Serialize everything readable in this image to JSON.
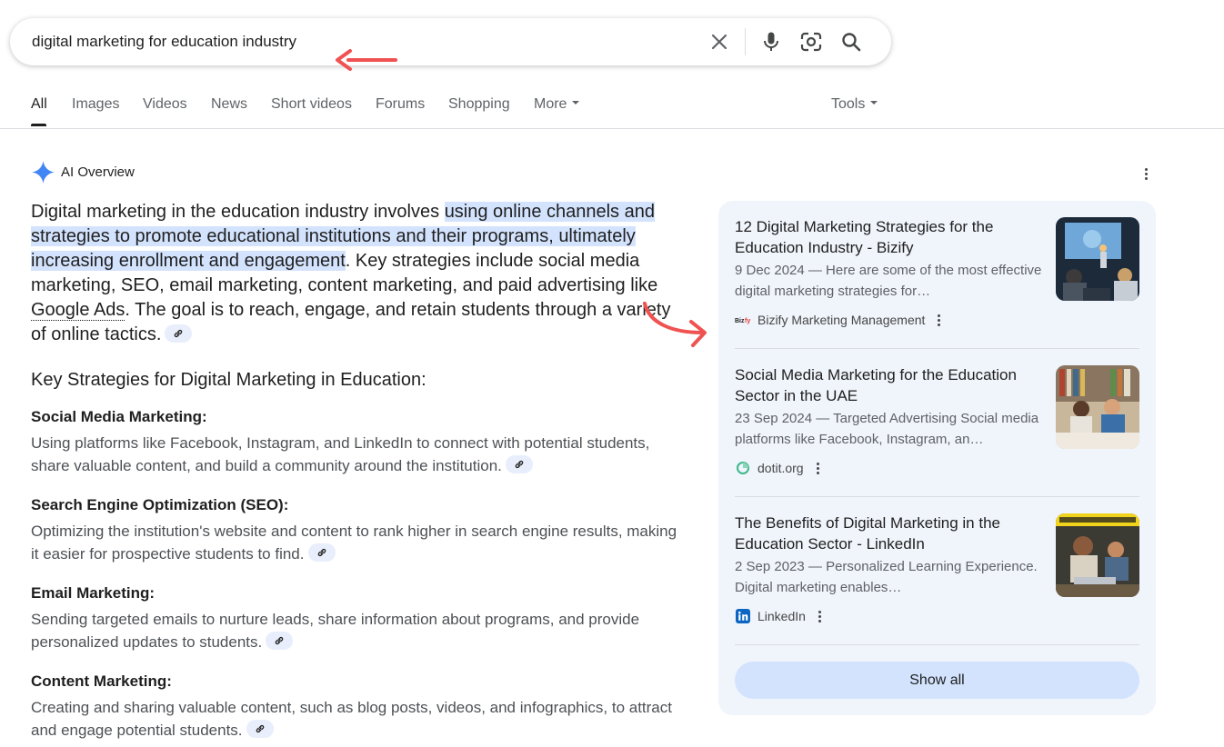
{
  "search": {
    "query": "digital marketing for education industry"
  },
  "tabs": [
    {
      "label": "All",
      "active": true
    },
    {
      "label": "Images"
    },
    {
      "label": "Videos"
    },
    {
      "label": "News"
    },
    {
      "label": "Short videos"
    },
    {
      "label": "Forums"
    },
    {
      "label": "Shopping"
    },
    {
      "label": "More"
    }
  ],
  "tools_label": "Tools",
  "ai_overview": {
    "label": "AI Overview",
    "intro": {
      "p1": "Digital marketing in the education industry involves ",
      "highlight": "using online channels and strategies to promote educational institutions and their programs, ultimately increasing enrollment and engagement",
      "p2": ". Key strategies include social media marketing, SEO, email marketing, content marketing, and paid advertising like ",
      "link": "Google Ads",
      "p3": ". The goal is to reach, engage, and retain students through a variety of online tactics."
    },
    "subheading": "Key Strategies for Digital Marketing in Education:",
    "strategies": [
      {
        "title": "Social Media Marketing:",
        "body": "Using platforms like Facebook, Instagram, and LinkedIn to connect with potential students, share valuable content, and build a community around the institution."
      },
      {
        "title": "Search Engine Optimization (SEO):",
        "body": "Optimizing the institution's website and content to rank higher in search engine results, making it easier for prospective students to find."
      },
      {
        "title": "Email Marketing:",
        "body": "Sending targeted emails to nurture leads, share information about programs, and provide personalized updates to students."
      },
      {
        "title": "Content Marketing:",
        "body": "Creating and sharing valuable content, such as blog posts, videos, and infographics, to attract and engage potential students."
      }
    ]
  },
  "sources": [
    {
      "title": "12 Digital Marketing Strategies for the Education Industry - Bizify",
      "snippet": "9 Dec 2024 — Here are some of the most effective digital marketing strategies for…",
      "source": "Bizify Marketing Management",
      "favicon": "bizify-favicon"
    },
    {
      "title": "Social Media Marketing for the Education Sector in the UAE",
      "snippet": "23 Sep 2024 — Targeted Advertising Social media platforms like Facebook, Instagram, an…",
      "source": "dotit.org",
      "favicon": "dotit-favicon"
    },
    {
      "title": "The Benefits of Digital Marketing in the Education Sector - LinkedIn",
      "snippet": "2 Sep 2023 — Personalized Learning Experience. Digital marketing enables…",
      "source": "LinkedIn",
      "favicon": "linkedin-favicon"
    }
  ],
  "show_all_label": "Show all",
  "colors": {
    "accent_blue": "#4285f4",
    "highlight": "#d3e3fd",
    "panel_bg": "#f0f4fb",
    "annotation_red": "#f05252"
  }
}
